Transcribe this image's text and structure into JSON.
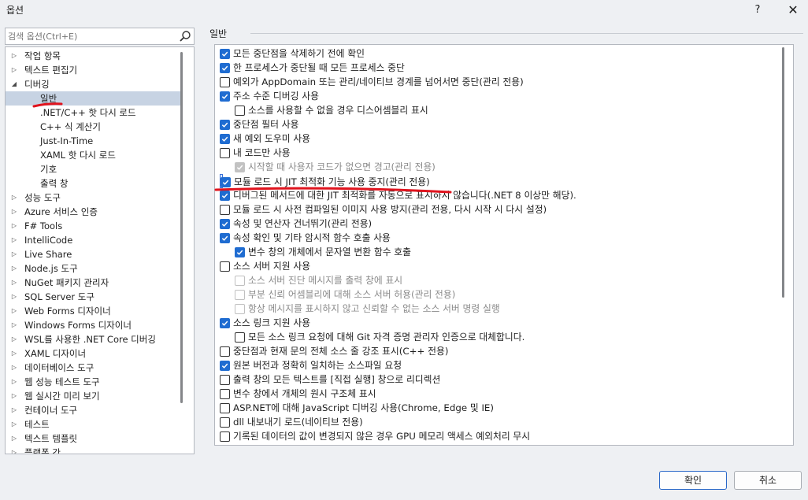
{
  "window": {
    "title": "옵션",
    "help": "?",
    "close": "✕"
  },
  "search": {
    "placeholder": "검색 옵션(Ctrl+E)"
  },
  "tree": [
    {
      "label": "작업 항목",
      "level": 0,
      "state": "collapsed"
    },
    {
      "label": "텍스트 편집기",
      "level": 0,
      "state": "collapsed"
    },
    {
      "label": "디버깅",
      "level": 0,
      "state": "expanded"
    },
    {
      "label": "일반",
      "level": 1,
      "state": "selected"
    },
    {
      "label": ".NET/C++ 핫 다시 로드",
      "level": 1,
      "state": "leaf"
    },
    {
      "label": "C++ 식 계산기",
      "level": 1,
      "state": "leaf"
    },
    {
      "label": "Just-In-Time",
      "level": 1,
      "state": "leaf"
    },
    {
      "label": "XAML 핫 다시 로드",
      "level": 1,
      "state": "leaf"
    },
    {
      "label": "기호",
      "level": 1,
      "state": "leaf"
    },
    {
      "label": "출력 창",
      "level": 1,
      "state": "leaf"
    },
    {
      "label": "성능 도구",
      "level": 0,
      "state": "collapsed"
    },
    {
      "label": "Azure 서비스 인증",
      "level": 0,
      "state": "collapsed"
    },
    {
      "label": "F# Tools",
      "level": 0,
      "state": "collapsed"
    },
    {
      "label": "IntelliCode",
      "level": 0,
      "state": "collapsed"
    },
    {
      "label": "Live Share",
      "level": 0,
      "state": "collapsed"
    },
    {
      "label": "Node.js 도구",
      "level": 0,
      "state": "collapsed"
    },
    {
      "label": "NuGet 패키지 관리자",
      "level": 0,
      "state": "collapsed"
    },
    {
      "label": "SQL Server 도구",
      "level": 0,
      "state": "collapsed"
    },
    {
      "label": "Web Forms 디자이너",
      "level": 0,
      "state": "collapsed"
    },
    {
      "label": "Windows Forms 디자이너",
      "level": 0,
      "state": "collapsed"
    },
    {
      "label": "WSL를 사용한 .NET Core 디버깅",
      "level": 0,
      "state": "collapsed"
    },
    {
      "label": "XAML 디자이너",
      "level": 0,
      "state": "collapsed"
    },
    {
      "label": "데이터베이스 도구",
      "level": 0,
      "state": "collapsed"
    },
    {
      "label": "웹 성능 테스트 도구",
      "level": 0,
      "state": "collapsed"
    },
    {
      "label": "웹 실시간 미리 보기",
      "level": 0,
      "state": "collapsed"
    },
    {
      "label": "컨테이너 도구",
      "level": 0,
      "state": "collapsed"
    },
    {
      "label": "테스트",
      "level": 0,
      "state": "collapsed"
    },
    {
      "label": "텍스트 템플릿",
      "level": 0,
      "state": "collapsed"
    },
    {
      "label": "플랫폼 간",
      "level": 0,
      "state": "collapsed"
    }
  ],
  "section": {
    "label": "일반"
  },
  "options": [
    {
      "label": "모든 중단점을 삭제하기 전에 확인",
      "checked": true,
      "indent": 0,
      "disabled": false
    },
    {
      "label": "한 프로세스가 중단될 때 모든 프로세스 중단",
      "checked": true,
      "indent": 0,
      "disabled": false
    },
    {
      "label": "예외가 AppDomain 또는 관리/네이티브 경계를 넘어서면 중단(관리 전용)",
      "checked": false,
      "indent": 0,
      "disabled": false
    },
    {
      "label": "주소 수준 디버깅 사용",
      "checked": true,
      "indent": 0,
      "disabled": false
    },
    {
      "label": "소스를 사용할 수 없을 경우 디스어셈블리 표시",
      "checked": false,
      "indent": 1,
      "disabled": false
    },
    {
      "label": "중단점 필터 사용",
      "checked": true,
      "indent": 0,
      "disabled": false
    },
    {
      "label": "새 예외 도우미 사용",
      "checked": true,
      "indent": 0,
      "disabled": false
    },
    {
      "label": "내 코드만 사용",
      "checked": false,
      "indent": 0,
      "disabled": false
    },
    {
      "label": "시작할 때 사용자 코드가 없으면 경고(관리 전용)",
      "checked": true,
      "indent": 1,
      "disabled": true
    },
    {
      "label": "모듈 로드 시 JIT 최적화 기능 사용 중지(관리 전용)",
      "checked": true,
      "indent": 0,
      "disabled": false,
      "highlighted": true
    },
    {
      "label": "디버그된 메서드에 대한 JIT 최적화를 자동으로 표시하지 않습니다(.NET 8 이상만 해당).",
      "checked": true,
      "indent": 0,
      "disabled": false
    },
    {
      "label": "모듈 로드 시 사전 컴파일된 이미지 사용 방지(관리 전용, 다시 시작 시 다시 설정)",
      "checked": false,
      "indent": 0,
      "disabled": false
    },
    {
      "label": "속성 및 연산자 건너뛰기(관리 전용)",
      "checked": true,
      "indent": 0,
      "disabled": false
    },
    {
      "label": "속성 확인 및 기타 암시적 함수 호출 사용",
      "checked": true,
      "indent": 0,
      "disabled": false
    },
    {
      "label": "변수 창의 개체에서 문자열 변환 함수 호출",
      "checked": true,
      "indent": 1,
      "disabled": false
    },
    {
      "label": "소스 서버 지원 사용",
      "checked": false,
      "indent": 0,
      "disabled": false
    },
    {
      "label": "소스 서버 진단 메시지를 출력 창에 표시",
      "checked": false,
      "indent": 1,
      "disabled": true
    },
    {
      "label": "부분 신뢰 어셈블리에 대해 소스 서버 허용(관리 전용)",
      "checked": false,
      "indent": 1,
      "disabled": true
    },
    {
      "label": "항상 메시지를 표시하지 않고 신뢰할 수 없는 소스 서버 명령 실행",
      "checked": false,
      "indent": 1,
      "disabled": true
    },
    {
      "label": "소스 링크 지원 사용",
      "checked": true,
      "indent": 0,
      "disabled": false
    },
    {
      "label": "모든 소스 링크 요청에 대해 Git 자격 증명 관리자 인증으로 대체합니다.",
      "checked": false,
      "indent": 1,
      "disabled": false
    },
    {
      "label": "중단점과 현재 문의 전체 소스 줄 강조 표시(C++ 전용)",
      "checked": false,
      "indent": 0,
      "disabled": false
    },
    {
      "label": "원본 버전과 정확히 일치하는 소스파일 요청",
      "checked": true,
      "indent": 0,
      "disabled": false
    },
    {
      "label": "출력 창의 모든 텍스트를 [직접 실행] 창으로 리디렉션",
      "checked": false,
      "indent": 0,
      "disabled": false
    },
    {
      "label": "변수 창에서 개체의 원시 구조체 표시",
      "checked": false,
      "indent": 0,
      "disabled": false
    },
    {
      "label": "ASP.NET에 대해 JavaScript 디버깅 사용(Chrome, Edge 및 IE)",
      "checked": false,
      "indent": 0,
      "disabled": false
    },
    {
      "label": "dll 내보내기 로드(네이티브 전용)",
      "checked": false,
      "indent": 0,
      "disabled": false
    },
    {
      "label": "기록된 데이터의 값이 변경되지 않은 경우 GPU 메모리 액세스 예외처리 무시",
      "checked": false,
      "indent": 0,
      "disabled": false
    }
  ],
  "buttons": {
    "ok": "확인",
    "cancel": "취소"
  },
  "colors": {
    "accent": "#1f6cd1",
    "selection": "#c7d3e3",
    "annotation": "#e0141e"
  }
}
